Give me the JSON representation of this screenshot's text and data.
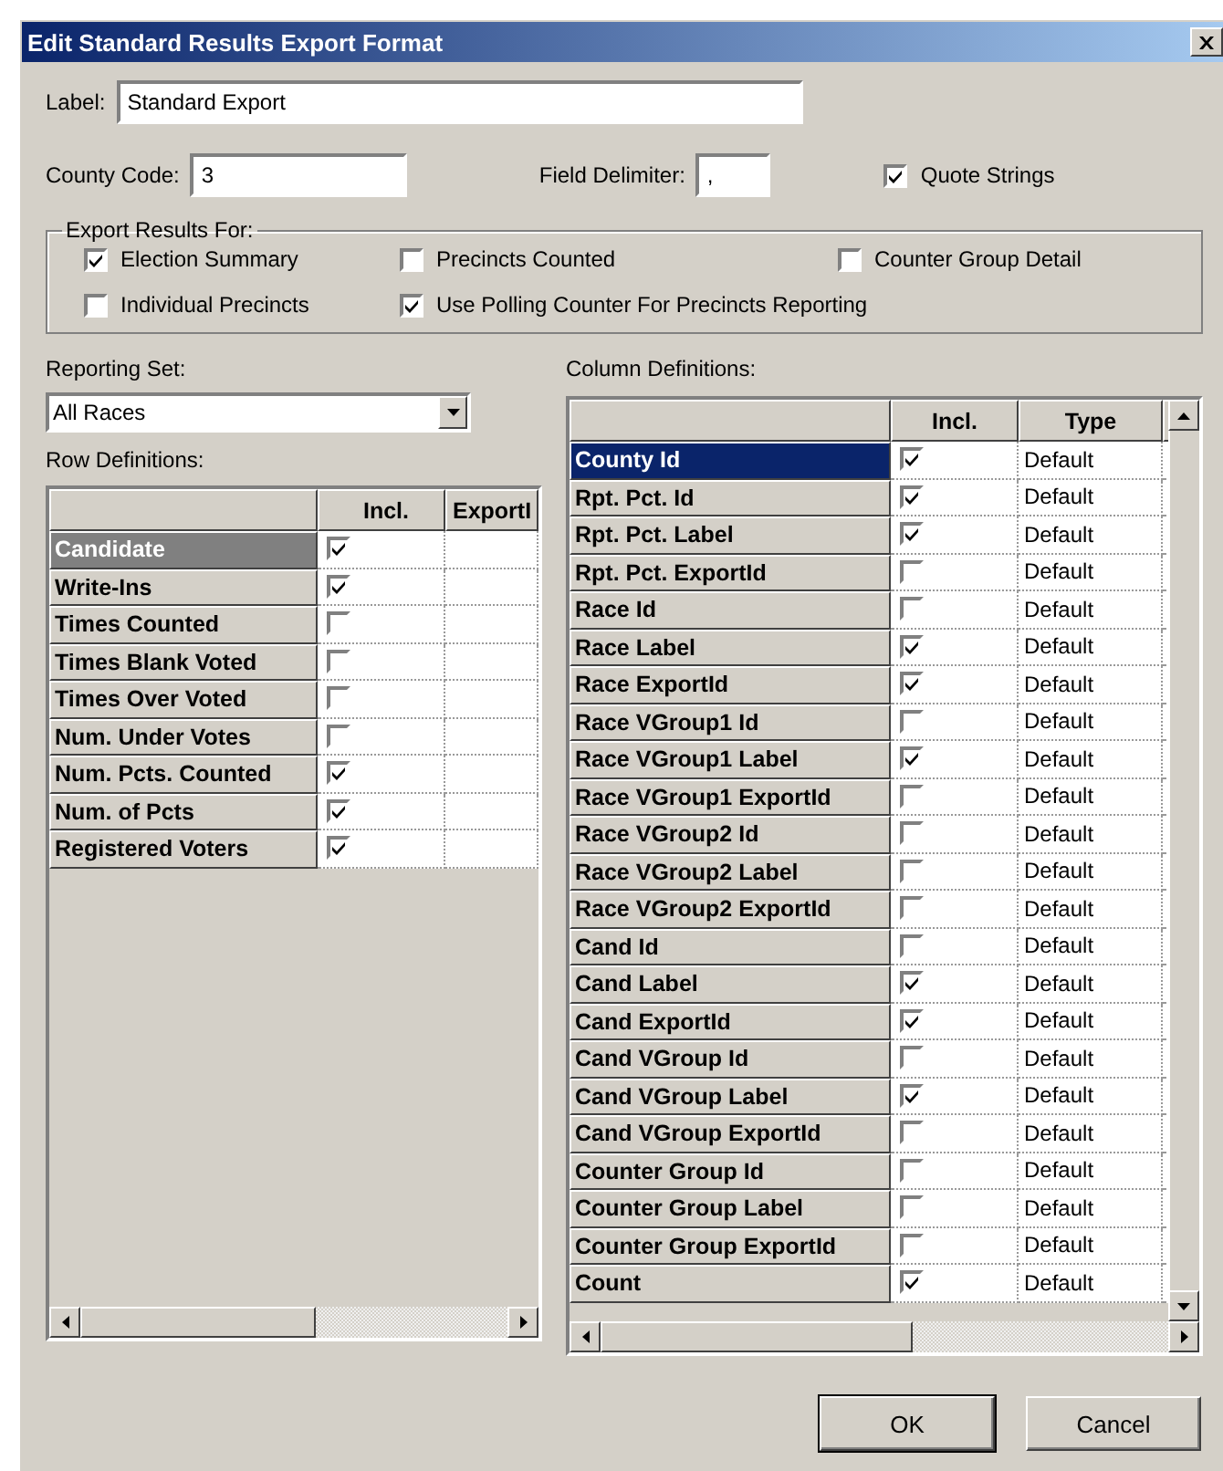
{
  "window": {
    "title": "Edit Standard Results Export Format"
  },
  "label_field": {
    "label": "Label:",
    "value": "Standard Export"
  },
  "county_code": {
    "label": "County Code:",
    "value": "3"
  },
  "field_delimiter": {
    "label": "Field Delimiter:",
    "value": ","
  },
  "quote_strings": {
    "label": "Quote Strings",
    "checked": true
  },
  "export_results_for": {
    "title": "Export Results For:",
    "options": [
      {
        "label": "Election Summary",
        "checked": true
      },
      {
        "label": "Precincts Counted",
        "checked": false
      },
      {
        "label": "Counter Group Detail",
        "checked": false
      },
      {
        "label": "Individual Precincts",
        "checked": false
      },
      {
        "label": "Use Polling Counter For Precincts Reporting",
        "checked": true
      }
    ]
  },
  "reporting_set": {
    "label": "Reporting Set:",
    "value": "All Races"
  },
  "row_definitions": {
    "label": "Row Definitions:",
    "columns": [
      "Incl.",
      "ExportI"
    ],
    "rows": [
      {
        "name": "Candidate",
        "included": true,
        "selected": true
      },
      {
        "name": "Write-Ins",
        "included": true,
        "selected": false
      },
      {
        "name": "Times Counted",
        "included": false,
        "selected": false
      },
      {
        "name": "Times Blank Voted",
        "included": false,
        "selected": false
      },
      {
        "name": "Times Over Voted",
        "included": false,
        "selected": false
      },
      {
        "name": "Num. Under Votes",
        "included": false,
        "selected": false
      },
      {
        "name": "Num. Pcts. Counted",
        "included": true,
        "selected": false
      },
      {
        "name": "Num. of Pcts",
        "included": true,
        "selected": false
      },
      {
        "name": "Registered Voters",
        "included": true,
        "selected": false
      }
    ]
  },
  "column_definitions": {
    "label": "Column Definitions:",
    "columns": [
      "Incl.",
      "Type"
    ],
    "rows": [
      {
        "name": "County Id",
        "included": true,
        "type": "Default",
        "selected": true
      },
      {
        "name": "Rpt. Pct. Id",
        "included": true,
        "type": "Default",
        "selected": false
      },
      {
        "name": "Rpt. Pct. Label",
        "included": true,
        "type": "Default",
        "selected": false
      },
      {
        "name": "Rpt. Pct. ExportId",
        "included": false,
        "type": "Default",
        "selected": false
      },
      {
        "name": "Race Id",
        "included": false,
        "type": "Default",
        "selected": false
      },
      {
        "name": "Race Label",
        "included": true,
        "type": "Default",
        "selected": false
      },
      {
        "name": "Race ExportId",
        "included": true,
        "type": "Default",
        "selected": false
      },
      {
        "name": "Race VGroup1 Id",
        "included": false,
        "type": "Default",
        "selected": false
      },
      {
        "name": "Race VGroup1 Label",
        "included": true,
        "type": "Default",
        "selected": false
      },
      {
        "name": "Race VGroup1 ExportId",
        "included": false,
        "type": "Default",
        "selected": false
      },
      {
        "name": "Race VGroup2 Id",
        "included": false,
        "type": "Default",
        "selected": false
      },
      {
        "name": "Race VGroup2 Label",
        "included": false,
        "type": "Default",
        "selected": false
      },
      {
        "name": "Race VGroup2 ExportId",
        "included": false,
        "type": "Default",
        "selected": false
      },
      {
        "name": "Cand Id",
        "included": false,
        "type": "Default",
        "selected": false
      },
      {
        "name": "Cand Label",
        "included": true,
        "type": "Default",
        "selected": false
      },
      {
        "name": "Cand ExportId",
        "included": true,
        "type": "Default",
        "selected": false
      },
      {
        "name": "Cand VGroup Id",
        "included": false,
        "type": "Default",
        "selected": false
      },
      {
        "name": "Cand VGroup Label",
        "included": true,
        "type": "Default",
        "selected": false
      },
      {
        "name": "Cand VGroup ExportId",
        "included": false,
        "type": "Default",
        "selected": false
      },
      {
        "name": "Counter Group Id",
        "included": false,
        "type": "Default",
        "selected": false
      },
      {
        "name": "Counter Group Label",
        "included": false,
        "type": "Default",
        "selected": false
      },
      {
        "name": "Counter Group ExportId",
        "included": false,
        "type": "Default",
        "selected": false
      },
      {
        "name": "Count",
        "included": true,
        "type": "Default",
        "selected": false
      }
    ]
  },
  "buttons": [
    "OK",
    "Cancel"
  ]
}
